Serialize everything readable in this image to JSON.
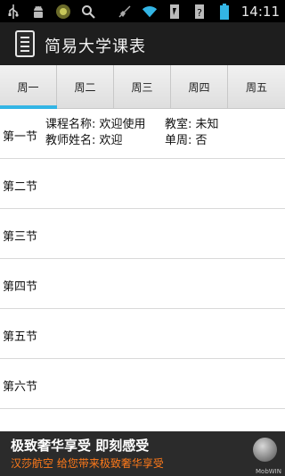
{
  "status_bar": {
    "time": "14:11",
    "icons": [
      "usb-icon",
      "android-debug-icon",
      "app-notification-icon",
      "search-icon",
      "mute-icon",
      "wifi-icon",
      "signal-icon",
      "no-sim-icon",
      "battery-icon"
    ]
  },
  "app": {
    "title": "简易大学课表",
    "icon": "document-icon"
  },
  "tabs": [
    {
      "label": "周一",
      "active": true
    },
    {
      "label": "周二",
      "active": false
    },
    {
      "label": "周三",
      "active": false
    },
    {
      "label": "周四",
      "active": false
    },
    {
      "label": "周五",
      "active": false
    }
  ],
  "periods": [
    {
      "label": "第一节",
      "course_name_label": "课程名称: 欢迎使用",
      "classroom_label": "教室: 未知",
      "teacher_label": "教师姓名: 欢迎",
      "week_label": "单周: 否"
    },
    {
      "label": "第二节"
    },
    {
      "label": "第三节"
    },
    {
      "label": "第四节"
    },
    {
      "label": "第五节"
    },
    {
      "label": "第六节"
    }
  ],
  "ad": {
    "title": "极致奢华享受 即刻感受",
    "subtitle": "汉莎航空 给您带来极致奢华享受",
    "brand": "MobWIN"
  },
  "colors": {
    "accent": "#33b5e5",
    "ad_subtitle": "#ff7a1a",
    "app_bar": "#1e1e1e"
  }
}
